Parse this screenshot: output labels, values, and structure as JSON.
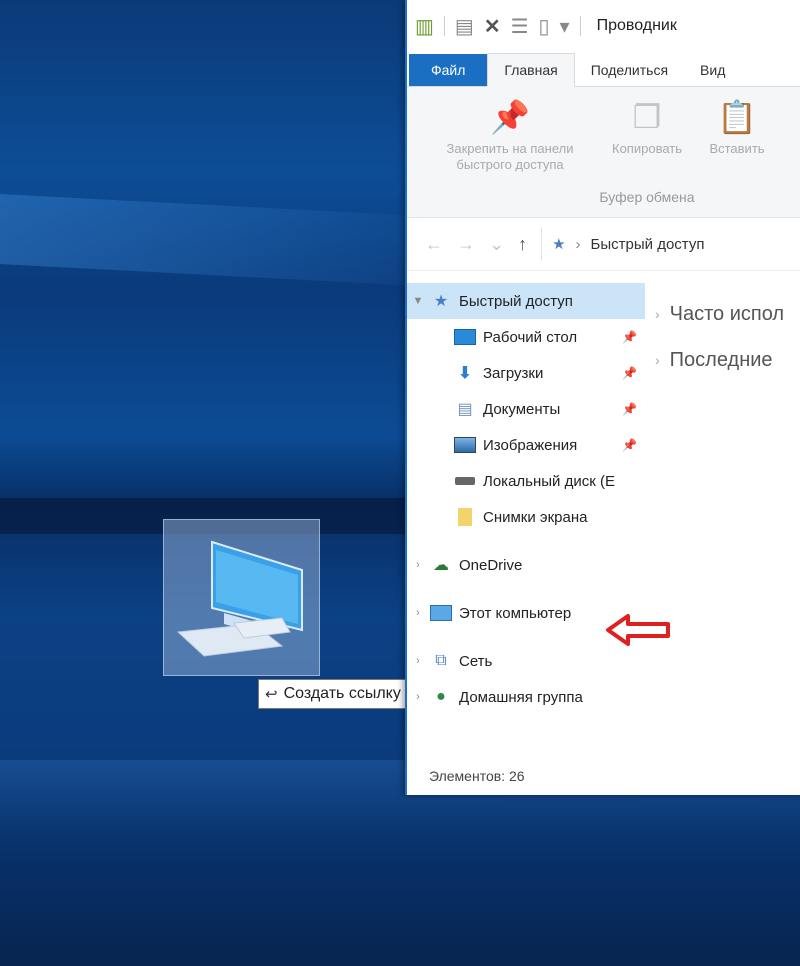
{
  "tooltip": {
    "text": "Создать ссылку в Рабочий стол"
  },
  "window": {
    "title": "Проводник",
    "tabs": {
      "file": "Файл",
      "home": "Главная",
      "share": "Поделиться",
      "view": "Вид"
    },
    "ribbon": {
      "pin_label_1": "Закрепить на панели",
      "pin_label_2": "быстрого доступа",
      "copy_label": "Копировать",
      "paste_label": "Вставить",
      "group_label": "Буфер обмена"
    },
    "address": {
      "location": "Быстрый доступ"
    },
    "nav": {
      "quick_access": "Быстрый доступ",
      "desktop": "Рабочий стол",
      "downloads": "Загрузки",
      "documents": "Документы",
      "pictures": "Изображения",
      "local_disk": "Локальный диск (Е",
      "screenshots": "Снимки экрана",
      "onedrive": "OneDrive",
      "this_pc": "Этот компьютер",
      "network": "Сеть",
      "homegroup": "Домашняя группа"
    },
    "content": {
      "frequent": "Часто испол",
      "recent": "Последние"
    },
    "status": "Элементов: 26"
  },
  "colors": {
    "accent": "#1a6fc2",
    "selected": "#cce4f7",
    "arrow": "#e02020"
  }
}
